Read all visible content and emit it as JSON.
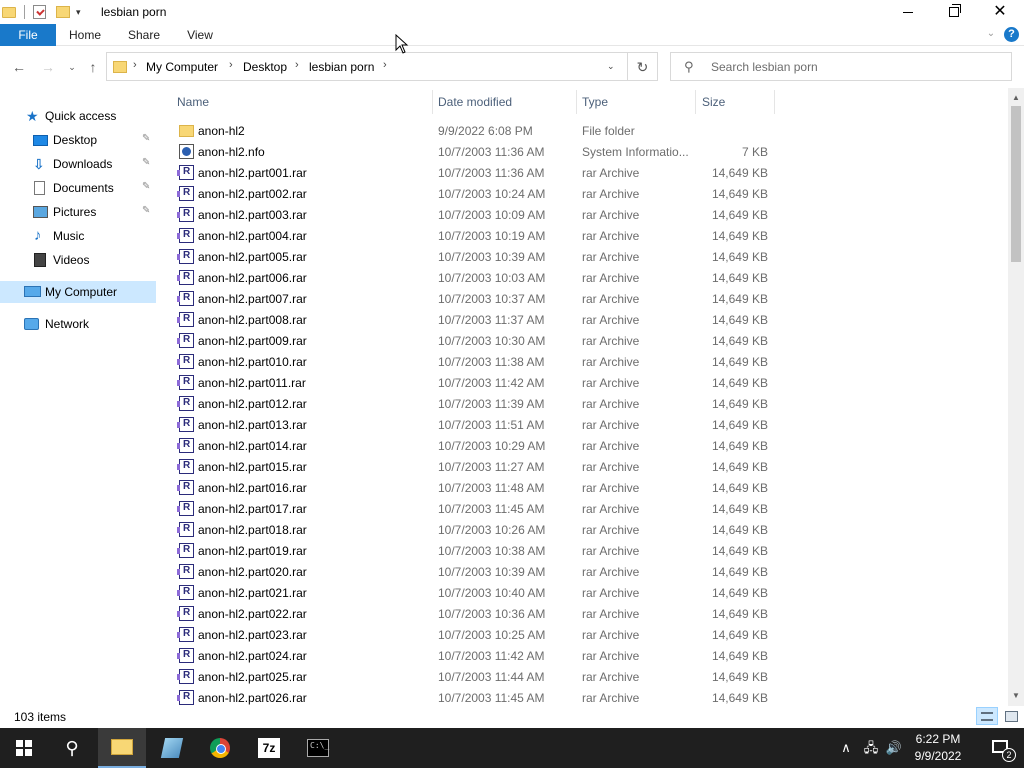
{
  "window": {
    "title": "lesbian porn",
    "qat_dropdown_glyph": "▾",
    "min_icon": "minimize-icon",
    "max_icon": "maximize-icon",
    "close_glyph": "✕"
  },
  "ribbon": {
    "tabs": [
      {
        "label": "File"
      },
      {
        "label": "Home"
      },
      {
        "label": "Share"
      },
      {
        "label": "View"
      }
    ],
    "expand_glyph": "⌄",
    "help_glyph": "?",
    "accent": "#1979ca"
  },
  "nav": {
    "back_glyph": "←",
    "forward_glyph": "→",
    "recent_glyph": "⌄",
    "up_glyph": "↑",
    "breadcrumb": [
      "My Computer",
      "Desktop",
      "lesbian porn"
    ],
    "crumb_sep": "›",
    "dropdown_glyph": "⌄",
    "refresh_glyph": "↻",
    "search_placeholder": "Search lesbian porn",
    "search_glyph": "⚲"
  },
  "sidebar": {
    "items": [
      {
        "label": "Quick access",
        "icon": "star-icon"
      },
      {
        "label": "Desktop",
        "icon": "desktop-icon",
        "pinned": true
      },
      {
        "label": "Downloads",
        "icon": "download-icon",
        "pinned": true
      },
      {
        "label": "Documents",
        "icon": "documents-icon",
        "pinned": true
      },
      {
        "label": "Pictures",
        "icon": "pictures-icon",
        "pinned": true
      },
      {
        "label": "Music",
        "icon": "music-icon"
      },
      {
        "label": "Videos",
        "icon": "videos-icon"
      },
      {
        "label": "My Computer",
        "icon": "computer-icon",
        "selected": true
      },
      {
        "label": "Network",
        "icon": "network-icon"
      }
    ],
    "pin_glyph": "📌",
    "selected_color": "#cce8ff"
  },
  "columns": {
    "name": "Name",
    "date": "Date modified",
    "type": "Type",
    "size": "Size",
    "sort_glyph": "^"
  },
  "files": [
    {
      "name": "anon-hl2",
      "date": "9/9/2022 6:08 PM",
      "type": "File folder",
      "size": "",
      "icon": "folder-icon"
    },
    {
      "name": "anon-hl2.nfo",
      "date": "10/7/2003 11:36 AM",
      "type": "System Informatio...",
      "size": "7 KB",
      "icon": "nfo-icon"
    },
    {
      "name": "anon-hl2.part001.rar",
      "date": "10/7/2003 11:36 AM",
      "type": "rar Archive",
      "size": "14,649 KB",
      "icon": "rar-icon"
    },
    {
      "name": "anon-hl2.part002.rar",
      "date": "10/7/2003 10:24 AM",
      "type": "rar Archive",
      "size": "14,649 KB",
      "icon": "rar-icon"
    },
    {
      "name": "anon-hl2.part003.rar",
      "date": "10/7/2003 10:09 AM",
      "type": "rar Archive",
      "size": "14,649 KB",
      "icon": "rar-icon"
    },
    {
      "name": "anon-hl2.part004.rar",
      "date": "10/7/2003 10:19 AM",
      "type": "rar Archive",
      "size": "14,649 KB",
      "icon": "rar-icon"
    },
    {
      "name": "anon-hl2.part005.rar",
      "date": "10/7/2003 10:39 AM",
      "type": "rar Archive",
      "size": "14,649 KB",
      "icon": "rar-icon"
    },
    {
      "name": "anon-hl2.part006.rar",
      "date": "10/7/2003 10:03 AM",
      "type": "rar Archive",
      "size": "14,649 KB",
      "icon": "rar-icon"
    },
    {
      "name": "anon-hl2.part007.rar",
      "date": "10/7/2003 10:37 AM",
      "type": "rar Archive",
      "size": "14,649 KB",
      "icon": "rar-icon"
    },
    {
      "name": "anon-hl2.part008.rar",
      "date": "10/7/2003 11:37 AM",
      "type": "rar Archive",
      "size": "14,649 KB",
      "icon": "rar-icon"
    },
    {
      "name": "anon-hl2.part009.rar",
      "date": "10/7/2003 10:30 AM",
      "type": "rar Archive",
      "size": "14,649 KB",
      "icon": "rar-icon"
    },
    {
      "name": "anon-hl2.part010.rar",
      "date": "10/7/2003 11:38 AM",
      "type": "rar Archive",
      "size": "14,649 KB",
      "icon": "rar-icon"
    },
    {
      "name": "anon-hl2.part011.rar",
      "date": "10/7/2003 11:42 AM",
      "type": "rar Archive",
      "size": "14,649 KB",
      "icon": "rar-icon"
    },
    {
      "name": "anon-hl2.part012.rar",
      "date": "10/7/2003 11:39 AM",
      "type": "rar Archive",
      "size": "14,649 KB",
      "icon": "rar-icon"
    },
    {
      "name": "anon-hl2.part013.rar",
      "date": "10/7/2003 11:51 AM",
      "type": "rar Archive",
      "size": "14,649 KB",
      "icon": "rar-icon"
    },
    {
      "name": "anon-hl2.part014.rar",
      "date": "10/7/2003 10:29 AM",
      "type": "rar Archive",
      "size": "14,649 KB",
      "icon": "rar-icon"
    },
    {
      "name": "anon-hl2.part015.rar",
      "date": "10/7/2003 11:27 AM",
      "type": "rar Archive",
      "size": "14,649 KB",
      "icon": "rar-icon"
    },
    {
      "name": "anon-hl2.part016.rar",
      "date": "10/7/2003 11:48 AM",
      "type": "rar Archive",
      "size": "14,649 KB",
      "icon": "rar-icon"
    },
    {
      "name": "anon-hl2.part017.rar",
      "date": "10/7/2003 11:45 AM",
      "type": "rar Archive",
      "size": "14,649 KB",
      "icon": "rar-icon"
    },
    {
      "name": "anon-hl2.part018.rar",
      "date": "10/7/2003 10:26 AM",
      "type": "rar Archive",
      "size": "14,649 KB",
      "icon": "rar-icon"
    },
    {
      "name": "anon-hl2.part019.rar",
      "date": "10/7/2003 10:38 AM",
      "type": "rar Archive",
      "size": "14,649 KB",
      "icon": "rar-icon"
    },
    {
      "name": "anon-hl2.part020.rar",
      "date": "10/7/2003 10:39 AM",
      "type": "rar Archive",
      "size": "14,649 KB",
      "icon": "rar-icon"
    },
    {
      "name": "anon-hl2.part021.rar",
      "date": "10/7/2003 10:40 AM",
      "type": "rar Archive",
      "size": "14,649 KB",
      "icon": "rar-icon"
    },
    {
      "name": "anon-hl2.part022.rar",
      "date": "10/7/2003 10:36 AM",
      "type": "rar Archive",
      "size": "14,649 KB",
      "icon": "rar-icon"
    },
    {
      "name": "anon-hl2.part023.rar",
      "date": "10/7/2003 10:25 AM",
      "type": "rar Archive",
      "size": "14,649 KB",
      "icon": "rar-icon"
    },
    {
      "name": "anon-hl2.part024.rar",
      "date": "10/7/2003 11:42 AM",
      "type": "rar Archive",
      "size": "14,649 KB",
      "icon": "rar-icon"
    },
    {
      "name": "anon-hl2.part025.rar",
      "date": "10/7/2003 11:44 AM",
      "type": "rar Archive",
      "size": "14,649 KB",
      "icon": "rar-icon"
    },
    {
      "name": "anon-hl2.part026.rar",
      "date": "10/7/2003 11:45 AM",
      "type": "rar Archive",
      "size": "14,649 KB",
      "icon": "rar-icon"
    }
  ],
  "scrollbar": {
    "up_glyph": "▲",
    "down_glyph": "▼"
  },
  "status": {
    "item_count": "103 items"
  },
  "taskbar": {
    "apps": [
      {
        "icon": "start-icon"
      },
      {
        "icon": "search-icon",
        "glyph": "⚲"
      },
      {
        "icon": "file-explorer-icon",
        "active": true
      },
      {
        "icon": "notepad-icon"
      },
      {
        "icon": "chrome-icon"
      },
      {
        "icon": "7zip-icon",
        "label": "7z"
      },
      {
        "icon": "command-prompt-icon",
        "label": "C:\\_"
      }
    ],
    "tray": {
      "chevron_glyph": "∧",
      "network_glyph": "🖧",
      "volume_glyph": "🔊",
      "time": "6:22 PM",
      "date": "9/9/2022",
      "notification_count": "2"
    },
    "background": "#1f1f1f"
  }
}
